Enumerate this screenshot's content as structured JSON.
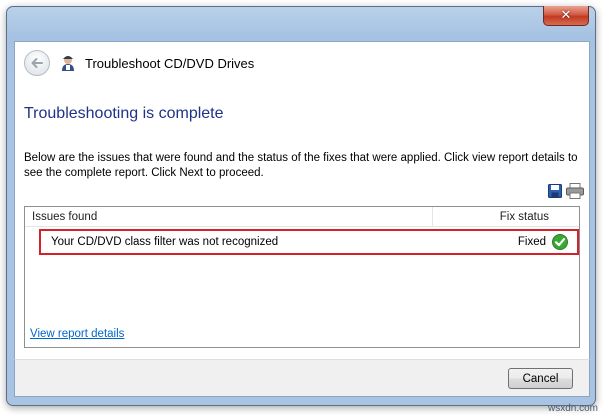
{
  "window": {
    "title": "Troubleshoot CD/DVD Drives",
    "close_glyph": "✕"
  },
  "icons": {
    "back": "back-arrow-icon",
    "wizard": "troubleshooter-icon",
    "save": "save-icon",
    "print": "print-icon",
    "status_ok": "check-icon"
  },
  "main": {
    "heading": "Troubleshooting is complete",
    "description": "Below are the issues that were found and the status of the fixes that were applied. Click view report details to see the complete report. Click Next to proceed.",
    "table": {
      "headers": [
        "Issues found",
        "Fix status"
      ],
      "rows": [
        {
          "issue": "Your CD/DVD class filter was not recognized",
          "status": "Fixed"
        }
      ]
    },
    "report_link": "View report details"
  },
  "footer": {
    "cancel_label": "Cancel"
  },
  "watermark": "wsxdn.com",
  "colors": {
    "heading": "#1e3287",
    "link": "#0066cc",
    "highlight_border": "#d6202a",
    "status_ok": "#3aa834"
  }
}
